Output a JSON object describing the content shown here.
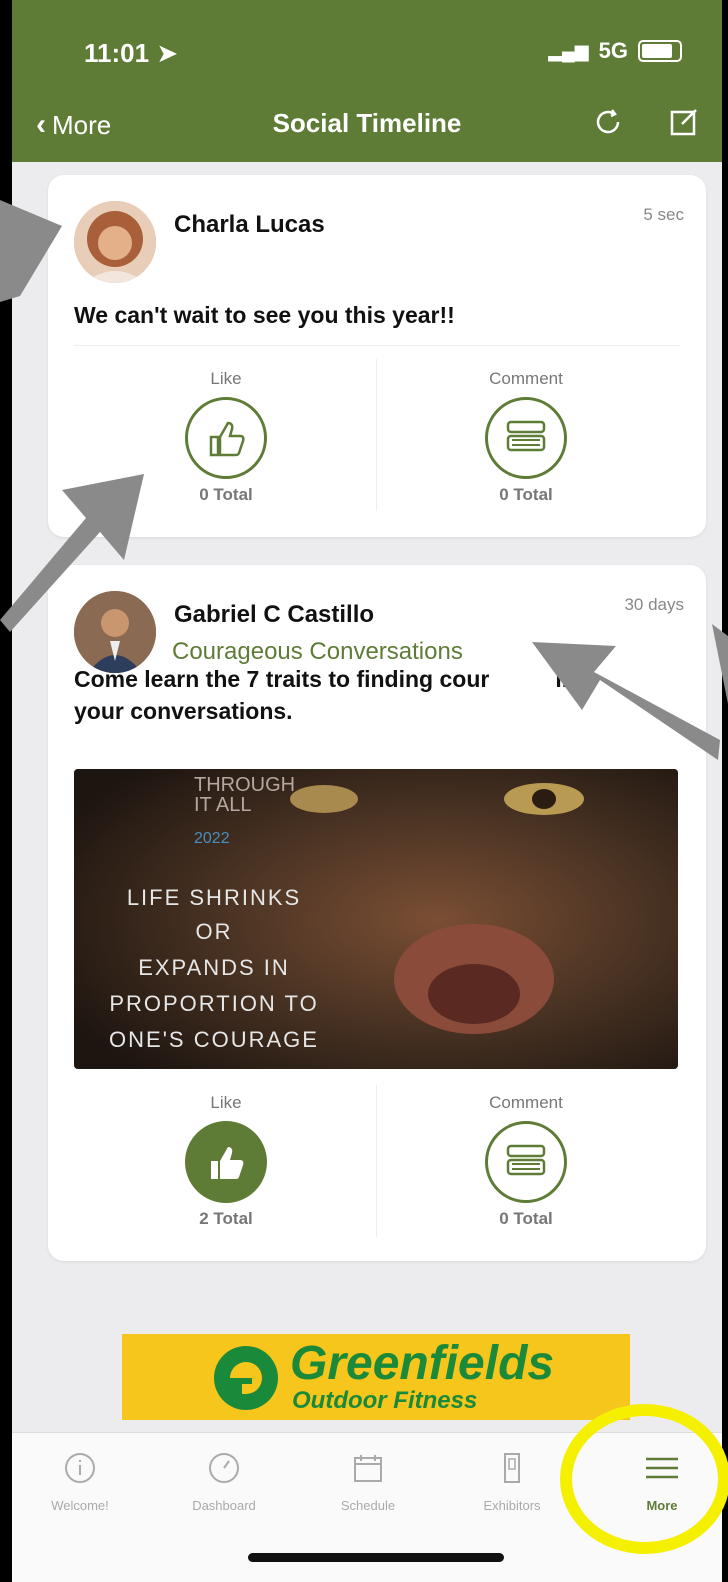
{
  "status": {
    "time": "11:01",
    "network": "5G"
  },
  "nav": {
    "back_label": "More",
    "title": "Social Timeline"
  },
  "posts": [
    {
      "author": "Charla Lucas",
      "time": "5 sec",
      "text": "We can't wait to see you this year!!",
      "like_label": "Like",
      "like_total": "0 Total",
      "comment_label": "Comment",
      "comment_total": "0 Total",
      "liked": false
    },
    {
      "author": "Gabriel C Castillo",
      "time": "30 days",
      "tagline": "Courageous Conversations",
      "text_line1": "Come learn the 7 traits to finding cour",
      "text_line1b": "in",
      "text_line2": "your conversations.",
      "image": {
        "header": [
          "THROUGH",
          "IT ALL"
        ],
        "year": "2022",
        "quote": [
          "LIFE SHRINKS",
          "OR",
          "EXPANDS IN",
          "PROPORTION TO",
          "ONE'S COURAGE"
        ]
      },
      "like_label": "Like",
      "like_total": "2 Total",
      "comment_label": "Comment",
      "comment_total": "0 Total",
      "liked": true
    }
  ],
  "ad": {
    "brand": "Greenfields",
    "tagline": "Outdoor Fitness"
  },
  "tabs": [
    {
      "label": "Welcome!",
      "icon": "info-icon"
    },
    {
      "label": "Dashboard",
      "icon": "dashboard-icon"
    },
    {
      "label": "Schedule",
      "icon": "calendar-icon"
    },
    {
      "label": "Exhibitors",
      "icon": "booth-icon"
    },
    {
      "label": "More",
      "icon": "menu-icon"
    }
  ],
  "colors": {
    "brand": "#5f7c37",
    "ad_bg": "#f7c61c",
    "highlight": "#f5ef00"
  }
}
